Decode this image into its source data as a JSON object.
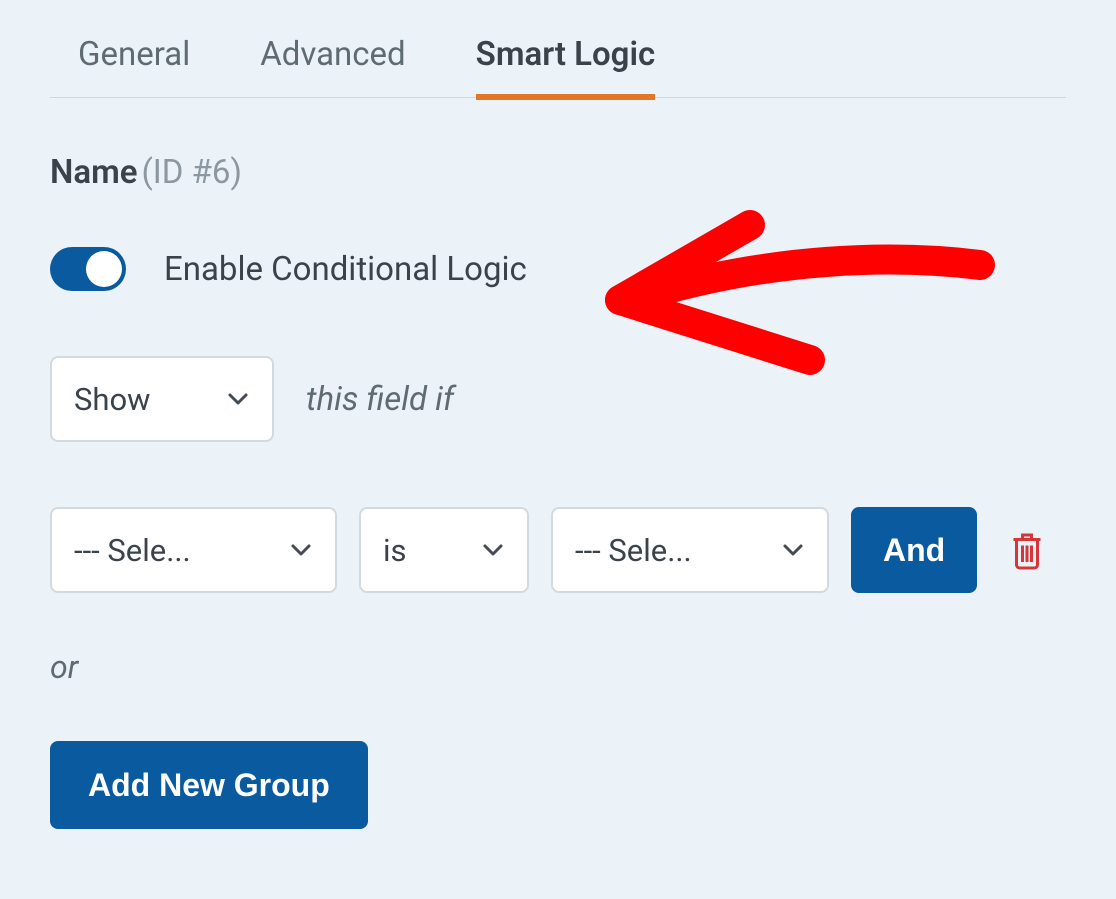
{
  "tabs": {
    "general": "General",
    "advanced": "Advanced",
    "smartLogic": "Smart Logic"
  },
  "field": {
    "name": "Name",
    "idLabel": "(ID #6)"
  },
  "toggle": {
    "label": "Enable Conditional Logic"
  },
  "action": {
    "select": "Show",
    "suffix": "this field if"
  },
  "condition": {
    "fieldSelect": "--- Sele...",
    "operator": "is",
    "valueSelect": "--- Sele...",
    "andButton": "And"
  },
  "orLabel": "or",
  "addGroup": "Add New Group"
}
